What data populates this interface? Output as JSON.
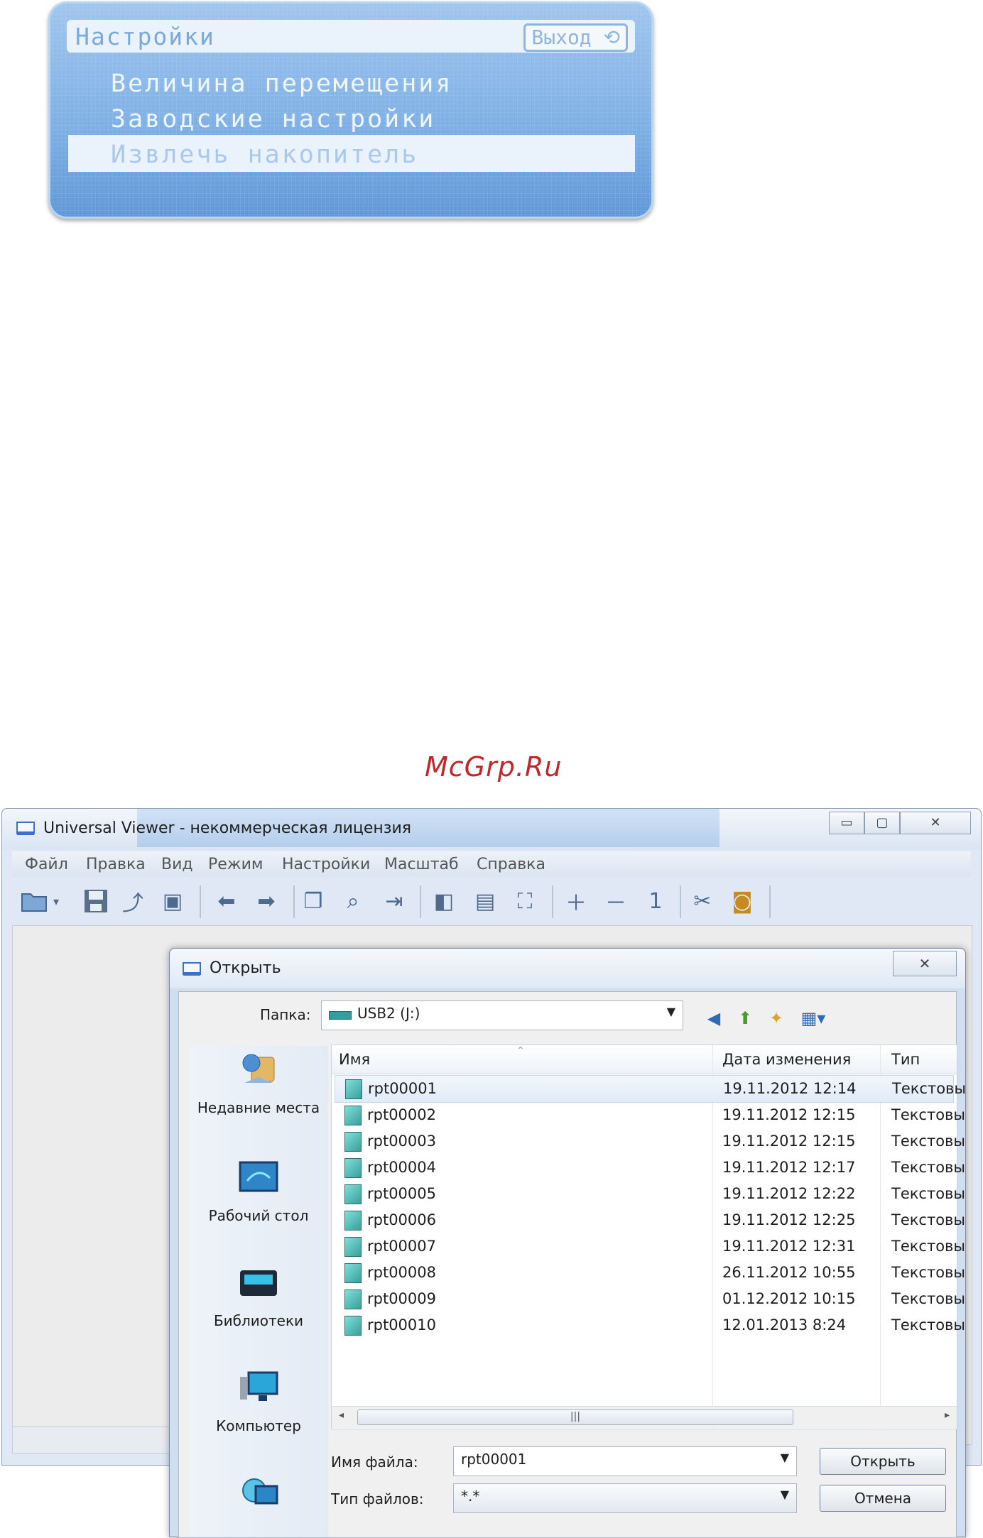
{
  "lcd_menu": {
    "title": "Настройки",
    "exit_label": "Выход",
    "items": [
      {
        "label": "Величина перемещения"
      },
      {
        "label": "Заводские настройки"
      },
      {
        "label": "Извлечь накопитель",
        "selected": true
      }
    ]
  },
  "watermark": "McGrp.Ru",
  "viewer": {
    "title": "Universal Viewer - некоммерческая лицензия",
    "menu": [
      "Файл",
      "Правка",
      "Вид",
      "Режим",
      "Настройки",
      "Масштаб",
      "Справка"
    ],
    "toolbar_zoom_value": "1"
  },
  "open_dialog": {
    "title": "Открыть",
    "folder_label": "Папка:",
    "folder_value": "USB2 (J:)",
    "places": [
      {
        "label": "Недавние места",
        "icon": "recent-places-icon"
      },
      {
        "label": "Рабочий стол",
        "icon": "desktop-icon"
      },
      {
        "label": "Библиотеки",
        "icon": "libraries-icon"
      },
      {
        "label": "Компьютер",
        "icon": "computer-icon"
      },
      {
        "label": "",
        "icon": "network-icon"
      }
    ],
    "columns": {
      "name": "Имя",
      "date": "Дата изменения",
      "type": "Тип"
    },
    "files": [
      {
        "name": "rpt00001",
        "date": "19.11.2012 12:14",
        "type": "Текстовы"
      },
      {
        "name": "rpt00002",
        "date": "19.11.2012 12:15",
        "type": "Текстовы"
      },
      {
        "name": "rpt00003",
        "date": "19.11.2012 12:15",
        "type": "Текстовы"
      },
      {
        "name": "rpt00004",
        "date": "19.11.2012 12:17",
        "type": "Текстовы"
      },
      {
        "name": "rpt00005",
        "date": "19.11.2012 12:22",
        "type": "Текстовы"
      },
      {
        "name": "rpt00006",
        "date": "19.11.2012 12:25",
        "type": "Текстовы"
      },
      {
        "name": "rpt00007",
        "date": "19.11.2012 12:31",
        "type": "Текстовы"
      },
      {
        "name": "rpt00008",
        "date": "26.11.2012 10:55",
        "type": "Текстовы"
      },
      {
        "name": "rpt00009",
        "date": "01.12.2012 10:15",
        "type": "Текстовы"
      },
      {
        "name": "rpt00010",
        "date": "12.01.2013 8:24",
        "type": "Текстовы"
      }
    ],
    "filename_label": "Имя файла:",
    "filename_value": "rpt00001",
    "filetype_label": "Тип файлов:",
    "filetype_value": "*.*",
    "open_button": "Открыть",
    "cancel_button": "Отмена"
  }
}
